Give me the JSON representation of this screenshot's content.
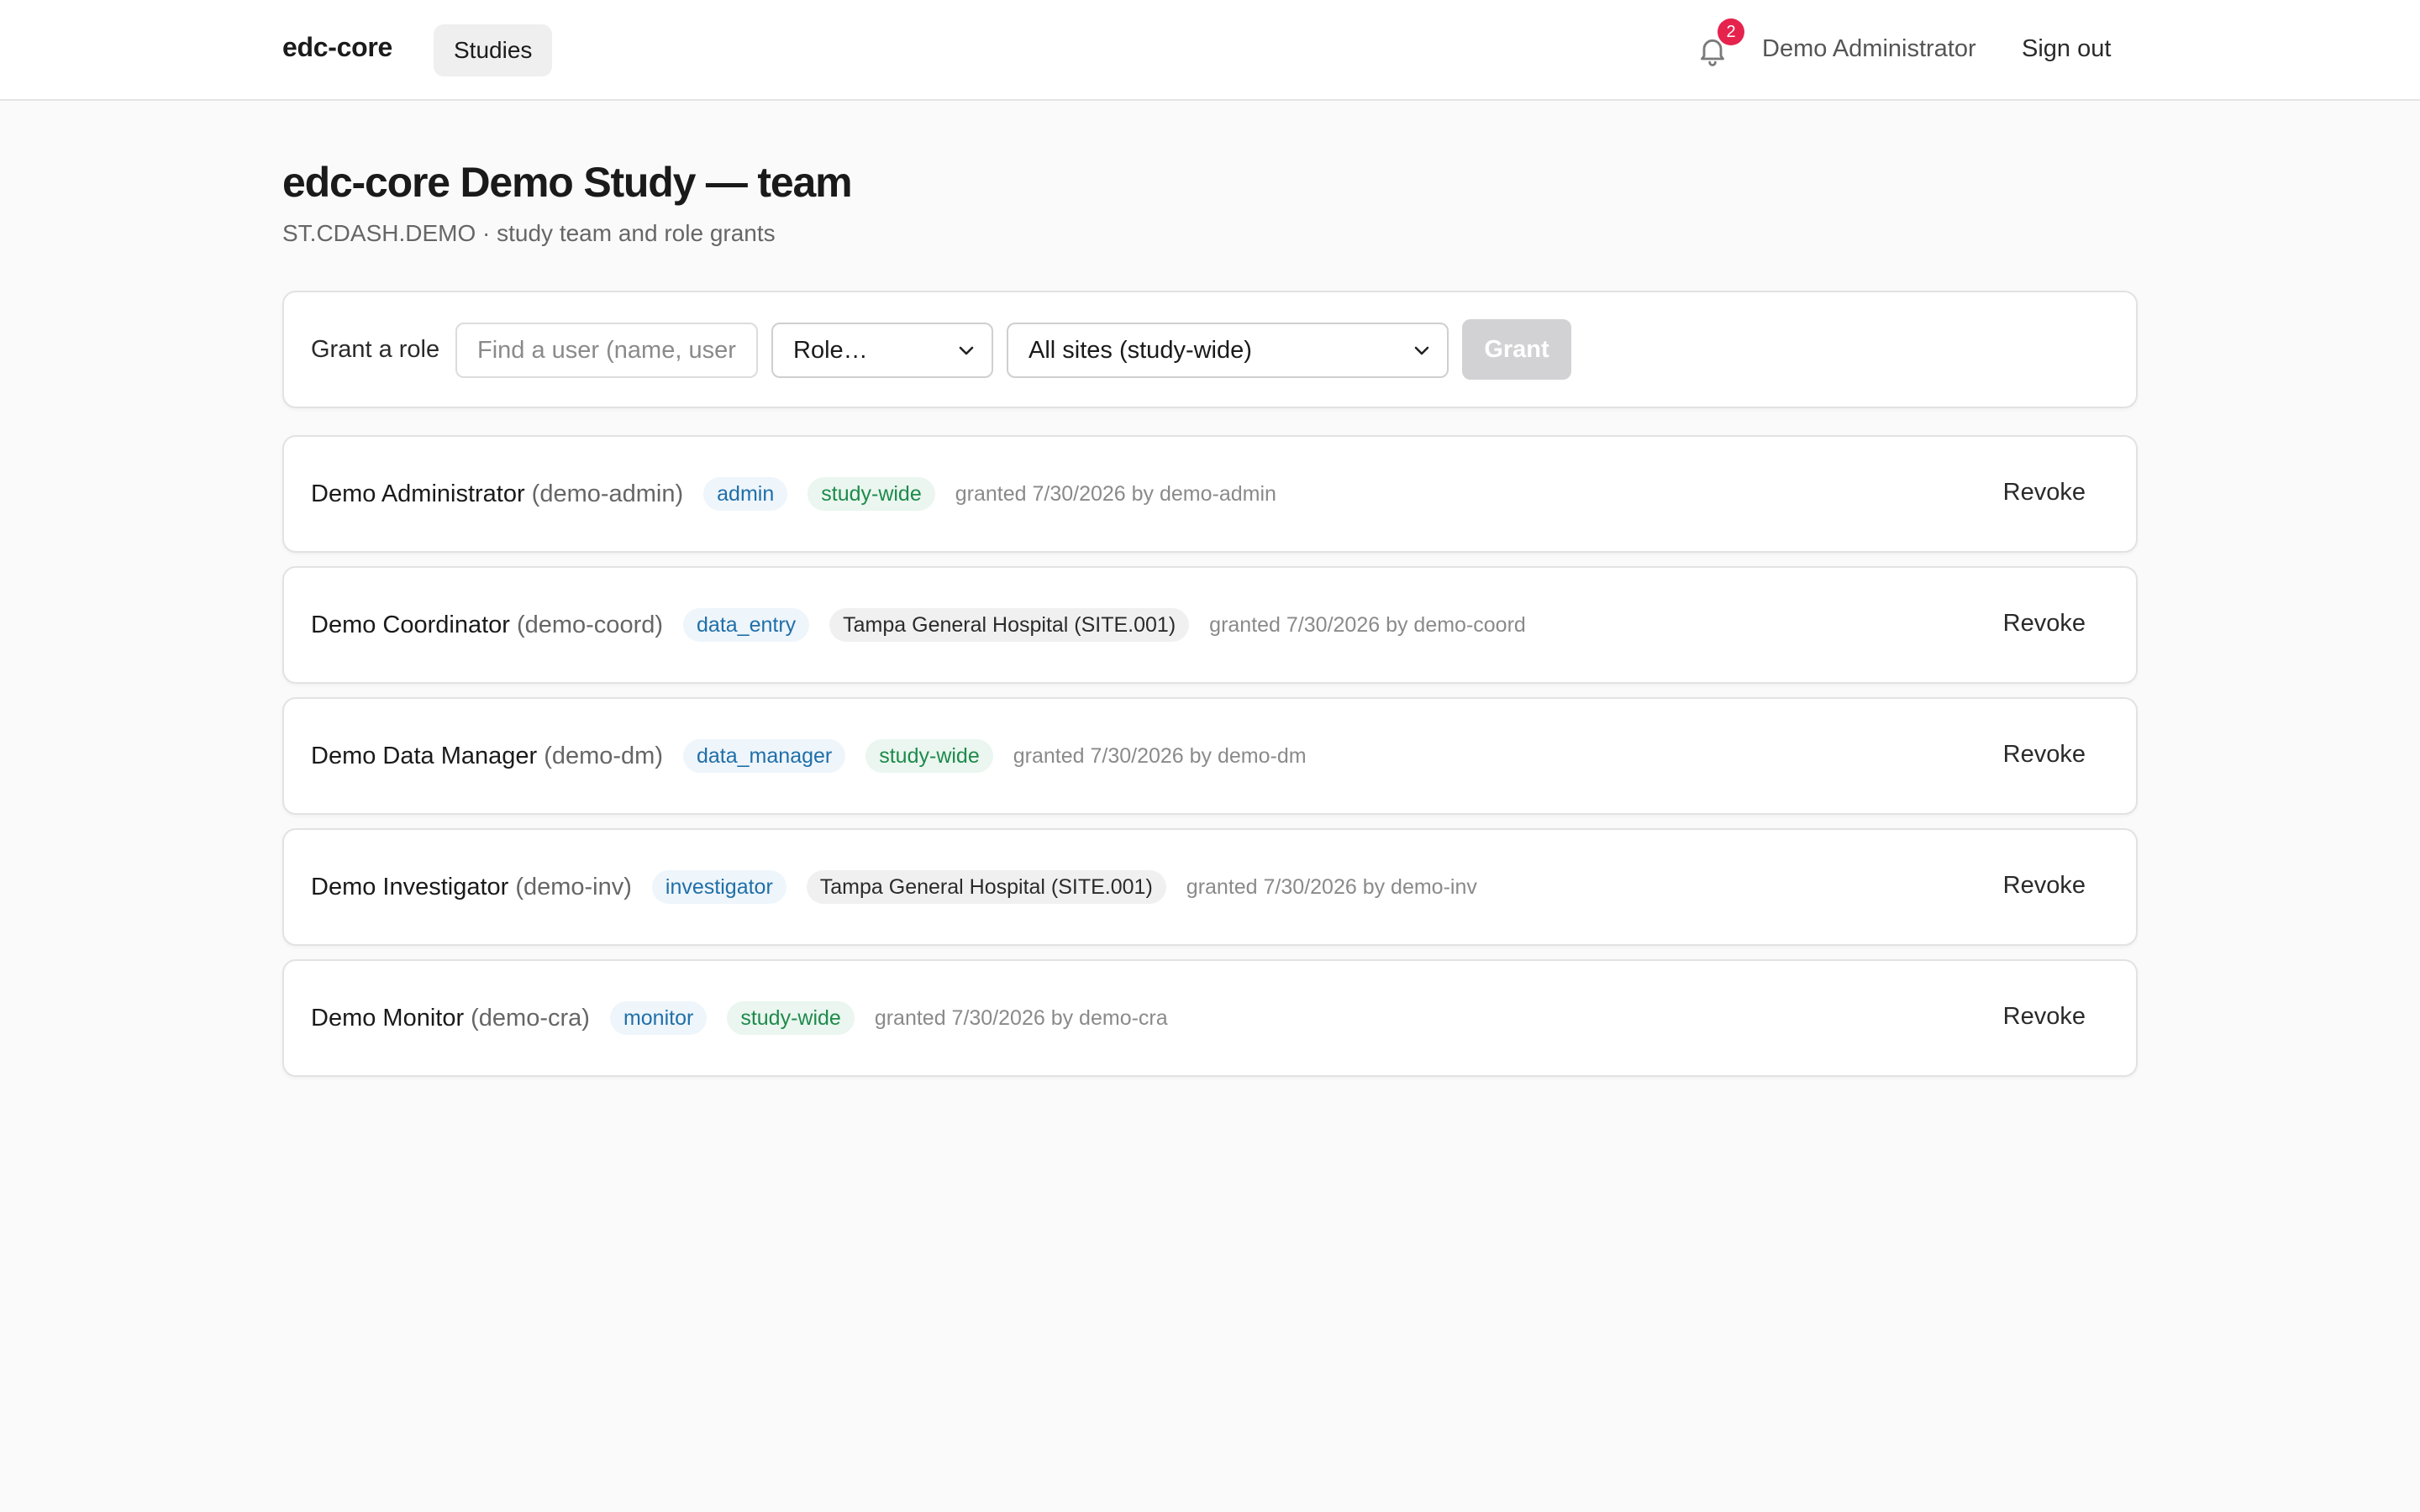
{
  "header": {
    "brand": "edc-core",
    "nav_studies": "Studies",
    "notification_count": "2",
    "user_name": "Demo Administrator",
    "sign_out": "Sign out"
  },
  "page": {
    "title": "edc-core Demo Study — team",
    "subtitle": "ST.CDASH.DEMO · study team and role grants"
  },
  "grant_form": {
    "label": "Grant a role",
    "user_placeholder": "Find a user (name, username…)",
    "role_value": "Role…",
    "site_value": "All sites (study-wide)",
    "grant_button": "Grant"
  },
  "members": [
    {
      "name": "Demo Administrator",
      "username": "(demo-admin)",
      "role": "admin",
      "scope": "study-wide",
      "scope_kind": "study-wide",
      "granted": "granted 7/30/2026 by demo-admin",
      "action": "Revoke"
    },
    {
      "name": "Demo Coordinator",
      "username": "(demo-coord)",
      "role": "data_entry",
      "scope": "Tampa General Hospital (SITE.001)",
      "scope_kind": "site",
      "granted": "granted 7/30/2026 by demo-coord",
      "action": "Revoke"
    },
    {
      "name": "Demo Data Manager",
      "username": "(demo-dm)",
      "role": "data_manager",
      "scope": "study-wide",
      "scope_kind": "study-wide",
      "granted": "granted 7/30/2026 by demo-dm",
      "action": "Revoke"
    },
    {
      "name": "Demo Investigator",
      "username": "(demo-inv)",
      "role": "investigator",
      "scope": "Tampa General Hospital (SITE.001)",
      "scope_kind": "site",
      "granted": "granted 7/30/2026 by demo-inv",
      "action": "Revoke"
    },
    {
      "name": "Demo Monitor",
      "username": "(demo-cra)",
      "role": "monitor",
      "scope": "study-wide",
      "scope_kind": "study-wide",
      "granted": "granted 7/30/2026 by demo-cra",
      "action": "Revoke"
    }
  ],
  "icons": {
    "notifications": "bell-icon",
    "select_arrow": "chevron-down-icon"
  },
  "colors": {
    "badge": "#e5234d",
    "role_pill_text": "#1f6fa8",
    "role_pill_bg": "#eef5fb",
    "wide_pill_text": "#1e8a4c",
    "wide_pill_bg": "#eaf6ef",
    "grant_disabled": "#d2d2d4",
    "page_background": "#fafafa"
  }
}
